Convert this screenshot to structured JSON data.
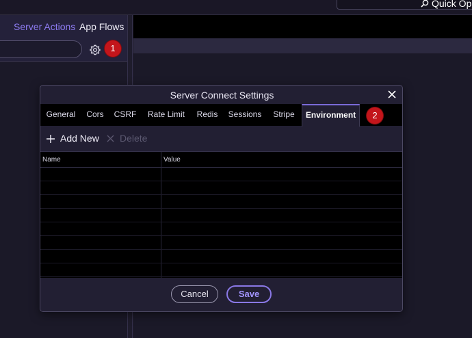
{
  "topbar": {
    "quick_open_label": "Quick Open"
  },
  "left_panel": {
    "tabs": [
      {
        "label": "Server Actions",
        "active": true
      },
      {
        "label": "App Flows",
        "active": false
      }
    ],
    "badge": "1"
  },
  "dialog": {
    "title": "Server Connect Settings",
    "tabs": [
      {
        "label": "General"
      },
      {
        "label": "Cors"
      },
      {
        "label": "CSRF"
      },
      {
        "label": "Rate Limit"
      },
      {
        "label": "Redis"
      },
      {
        "label": "Sessions"
      },
      {
        "label": "Stripe"
      },
      {
        "label": "Environment",
        "active": true
      }
    ],
    "badge": "2",
    "toolbar": {
      "add_label": "Add New",
      "delete_label": "Delete"
    },
    "grid": {
      "columns": [
        "Name",
        "Value"
      ],
      "rows": []
    },
    "footer": {
      "cancel_label": "Cancel",
      "save_label": "Save"
    }
  },
  "colors": {
    "accent": "#8e7cf2",
    "badge": "#c3151b",
    "background": "#201d2e"
  }
}
